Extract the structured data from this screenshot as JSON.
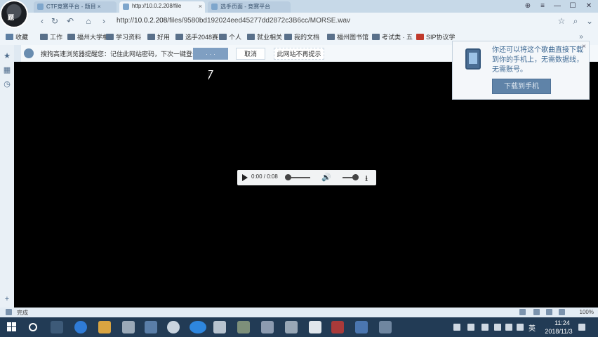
{
  "window": {
    "avatar_text": "题",
    "tabs": [
      {
        "label": "CTF竞赛平台 - 题目 ×"
      },
      {
        "label": "http://10.0.2.208/file"
      },
      {
        "label": "选手页面 - 竞赛平台"
      }
    ],
    "controls": {
      "pin": "⊕",
      "menu": "≡",
      "minimize": "—",
      "maximize": "☐",
      "close": "✕"
    }
  },
  "nav": {
    "url_prefix": "http://",
    "url_host": "10.0.2.208",
    "url_path": "/files/9580bd192024eed45277dd2872c3B6cc/MORSE.wav"
  },
  "bookmarks": [
    {
      "label": "收藏"
    },
    {
      "label": "工作"
    },
    {
      "label": "福州大学相"
    },
    {
      "label": "学习资料"
    },
    {
      "label": "好用"
    },
    {
      "label": "选手2048赛"
    },
    {
      "label": "个人"
    },
    {
      "label": "就业相关"
    },
    {
      "label": "我的文档"
    },
    {
      "label": "福州图书馆"
    },
    {
      "label": "考试类 · 五"
    },
    {
      "label": "SIP协议学"
    }
  ],
  "infobar": {
    "message": "搜狗高速浏览器提醒您：记住此网站密码，下次一键登录！",
    "save_label": "· · ·",
    "cancel_label": "取消",
    "never_label": "此网站不再提示"
  },
  "player": {
    "time": "0:00 / 0:08",
    "progress": 0.0,
    "volume": 0.9
  },
  "popup": {
    "message": "你还可以将这个歌曲直接下载到你的手机上，无需数据线，无需账号。",
    "button_label": "下载到手机"
  },
  "statusbar": {
    "status": "完成",
    "zoom": "100%"
  },
  "taskbar": {
    "ime": "英",
    "time": "11:24",
    "date": "2018/11/3"
  }
}
